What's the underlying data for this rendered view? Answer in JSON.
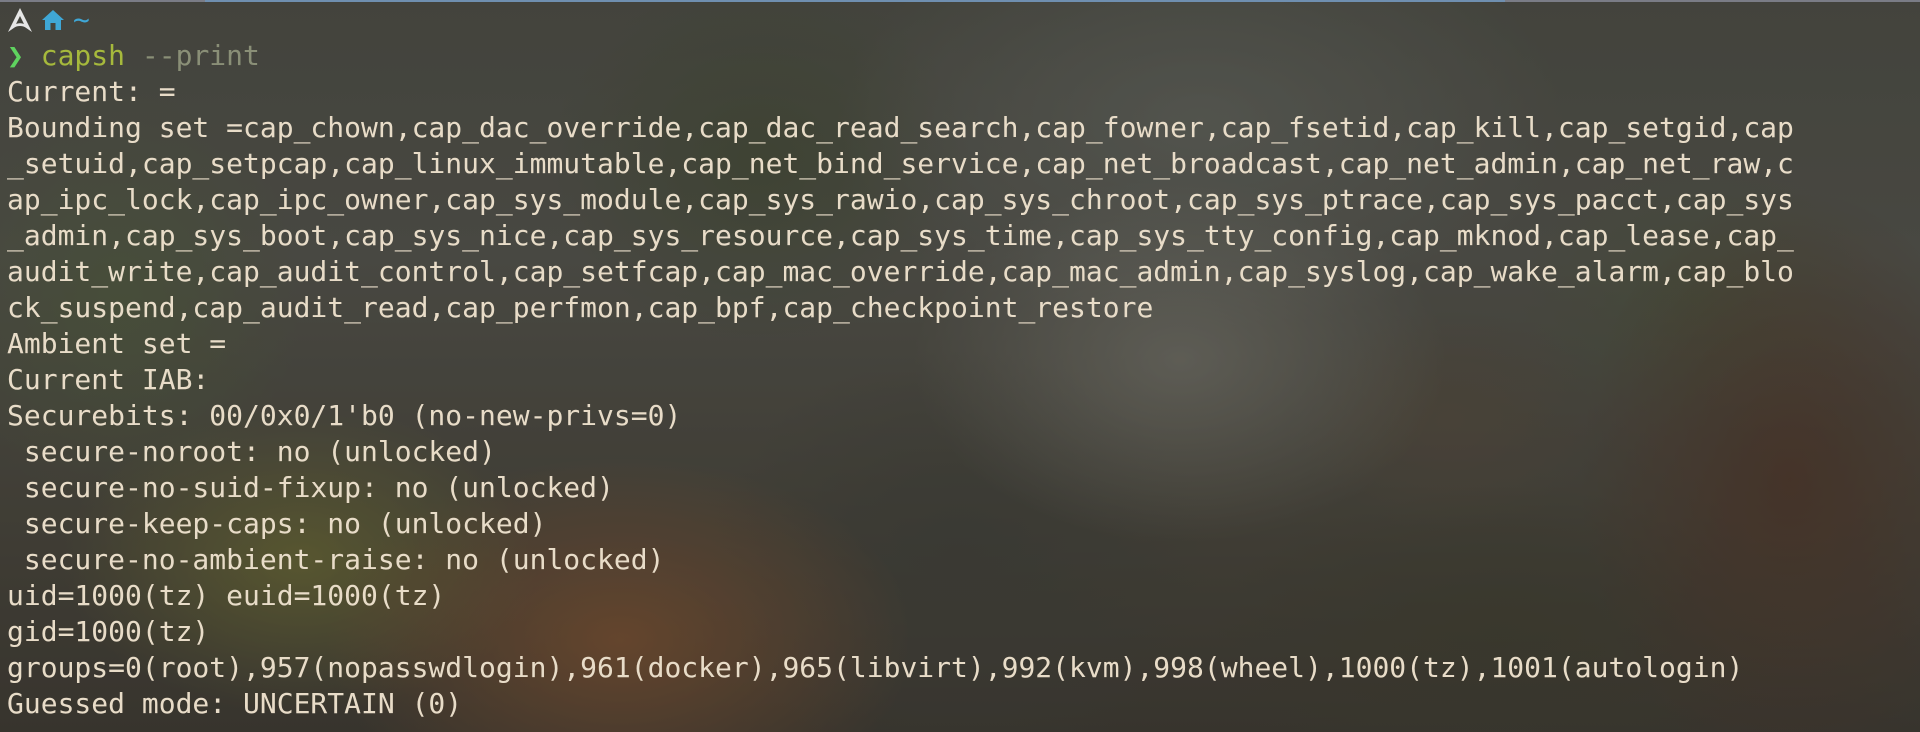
{
  "prompt": {
    "distro_icon": "arch-linux-icon",
    "home_icon": "home-icon",
    "cwd": "~",
    "symbol": "❯",
    "command": "capsh",
    "args": " --print"
  },
  "output": {
    "current": "Current: =",
    "bounding": [
      "Bounding set =cap_chown,cap_dac_override,cap_dac_read_search,cap_fowner,cap_fsetid,cap_kill,cap_setgid,cap",
      "_setuid,cap_setpcap,cap_linux_immutable,cap_net_bind_service,cap_net_broadcast,cap_net_admin,cap_net_raw,c",
      "ap_ipc_lock,cap_ipc_owner,cap_sys_module,cap_sys_rawio,cap_sys_chroot,cap_sys_ptrace,cap_sys_pacct,cap_sys",
      "_admin,cap_sys_boot,cap_sys_nice,cap_sys_resource,cap_sys_time,cap_sys_tty_config,cap_mknod,cap_lease,cap_",
      "audit_write,cap_audit_control,cap_setfcap,cap_mac_override,cap_mac_admin,cap_syslog,cap_wake_alarm,cap_blo",
      "ck_suspend,cap_audit_read,cap_perfmon,cap_bpf,cap_checkpoint_restore"
    ],
    "ambient": "Ambient set =",
    "iab": "Current IAB:",
    "securebits": "Securebits: 00/0x0/1'b0 (no-new-privs=0)",
    "secure_noroot": " secure-noroot: no (unlocked)",
    "secure_no_suid_fixup": " secure-no-suid-fixup: no (unlocked)",
    "secure_keep_caps": " secure-keep-caps: no (unlocked)",
    "secure_no_ambient_raise": " secure-no-ambient-raise: no (unlocked)",
    "uid": "uid=1000(tz) euid=1000(tz)",
    "gid": "gid=1000(tz)",
    "groups": "groups=0(root),957(nopasswdlogin),961(docker),965(libvirt),992(kvm),998(wheel),1000(tz),1001(autologin)",
    "mode": "Guessed mode: UNCERTAIN (0)"
  },
  "colors": {
    "text": "#e8dcc8",
    "prompt_symbol": "#5fd35f",
    "command": "#a6b93c",
    "cwd": "#3fa7d6"
  }
}
